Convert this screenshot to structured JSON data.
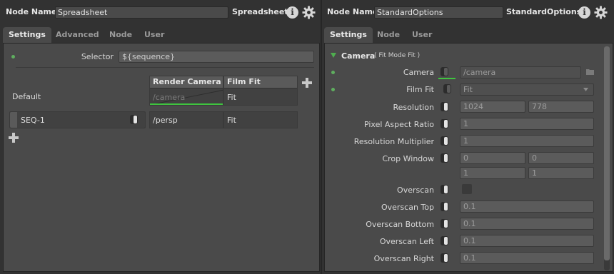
{
  "left": {
    "header": {
      "node_name_label": "Node Name",
      "node_name_value": "Spreadsheet",
      "node_type": "Spreadsheet"
    },
    "tabs": [
      {
        "label": "Settings",
        "active": true
      },
      {
        "label": "Advanced",
        "active": false
      },
      {
        "label": "Node",
        "active": false
      },
      {
        "label": "User",
        "active": false
      }
    ],
    "selector": {
      "label": "Selector",
      "value": "${sequence}"
    },
    "table": {
      "columns": [
        "Render Camera",
        "Film Fit"
      ],
      "default_row": {
        "label": "Default",
        "render_camera": "/camera",
        "film_fit": "Fit"
      },
      "rows": [
        {
          "name": "SEQ-1",
          "render_camera": "/persp",
          "film_fit": "Fit"
        }
      ]
    }
  },
  "right": {
    "header": {
      "node_name_label": "Node Name",
      "node_name_value": "StandardOptions",
      "node_type": "StandardOptions"
    },
    "tabs": [
      {
        "label": "Settings",
        "active": true
      },
      {
        "label": "Node",
        "active": false
      },
      {
        "label": "User",
        "active": false
      }
    ],
    "section": {
      "title": "Camera",
      "summary": "( Fit Mode Fit )"
    },
    "camera": {
      "label": "Camera",
      "value": "/camera"
    },
    "film_fit": {
      "label": "Film Fit",
      "value": "Fit"
    },
    "resolution": {
      "label": "Resolution",
      "x": "1024",
      "y": "778"
    },
    "pixel_aspect_ratio": {
      "label": "Pixel Aspect Ratio",
      "value": "1"
    },
    "resolution_multiplier": {
      "label": "Resolution Multiplier",
      "value": "1"
    },
    "crop_window": {
      "label": "Crop Window",
      "min_x": "0",
      "min_y": "0",
      "max_x": "1",
      "max_y": "1"
    },
    "overscan": {
      "label": "Overscan"
    },
    "overscan_top": {
      "label": "Overscan Top",
      "value": "0.1"
    },
    "overscan_bottom": {
      "label": "Overscan Bottom",
      "value": "0.1"
    },
    "overscan_left": {
      "label": "Overscan Left",
      "value": "0.1"
    },
    "overscan_right": {
      "label": "Overscan Right",
      "value": "0.1"
    }
  },
  "colors": {
    "accent_green": "#5fae5f",
    "panel_bg": "#4a4a4a",
    "window_bg": "#323232"
  },
  "icons": [
    "info-icon",
    "gear-icon",
    "plus-icon",
    "folder-icon",
    "triangle-down-icon",
    "dropdown-arrow-icon"
  ]
}
